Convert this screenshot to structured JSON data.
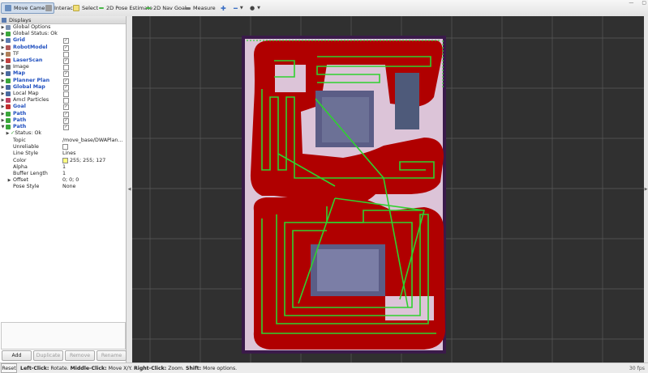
{
  "toolbar": {
    "tools": [
      {
        "label": "Move Camera",
        "icon": "move-camera-icon",
        "active": true
      },
      {
        "label": "Interact",
        "icon": "interact-icon"
      },
      {
        "label": "Select",
        "icon": "select-icon"
      },
      {
        "label": "2D Pose Estimate",
        "icon": "pose-estimate-icon"
      },
      {
        "label": "2D Nav Goal",
        "icon": "nav-goal-icon"
      },
      {
        "label": "Measure",
        "icon": "measure-icon"
      }
    ]
  },
  "displays": {
    "title": "Displays",
    "items": [
      {
        "label": "Global Options",
        "icon": "gear-icon",
        "blue": false,
        "check": null,
        "arrow": "▶"
      },
      {
        "label": "Global Status: Ok",
        "icon": "check-icon",
        "blue": false,
        "check": null,
        "arrow": "▶"
      },
      {
        "label": "Grid",
        "icon": "grid-icon",
        "blue": true,
        "check": true,
        "arrow": "▶"
      },
      {
        "label": "RobotModel",
        "icon": "robot-icon",
        "blue": true,
        "check": true,
        "arrow": "▶"
      },
      {
        "label": "TF",
        "icon": "tf-icon",
        "blue": false,
        "check": false,
        "arrow": "▶"
      },
      {
        "label": "LaserScan",
        "icon": "laser-icon",
        "blue": true,
        "check": true,
        "arrow": "▶"
      },
      {
        "label": "Image",
        "icon": "image-icon",
        "blue": false,
        "check": false,
        "arrow": "▶"
      },
      {
        "label": "Map",
        "icon": "map-icon",
        "blue": true,
        "check": true,
        "arrow": "▶"
      },
      {
        "label": "Planner Plan",
        "icon": "path-icon",
        "blue": true,
        "check": true,
        "arrow": "▶"
      },
      {
        "label": "Global Map",
        "icon": "map-folder-icon",
        "blue": true,
        "check": true,
        "arrow": "▶"
      },
      {
        "label": "Local Map",
        "icon": "map-folder-icon",
        "blue": false,
        "check": false,
        "arrow": "▶"
      },
      {
        "label": "Amcl Particles",
        "icon": "particles-icon",
        "blue": false,
        "check": false,
        "arrow": "▶"
      },
      {
        "label": "Goal",
        "icon": "goal-icon",
        "blue": true,
        "check": true,
        "arrow": "▶"
      },
      {
        "label": "Path",
        "icon": "path-icon",
        "blue": true,
        "check": true,
        "arrow": "▶"
      },
      {
        "label": "Path",
        "icon": "path-icon",
        "blue": true,
        "check": true,
        "arrow": "▶"
      },
      {
        "label": "Path",
        "icon": "path-icon",
        "blue": true,
        "check": true,
        "arrow": "▼"
      }
    ],
    "status_ok": "Status: Ok",
    "properties": [
      {
        "key": "Topic",
        "value": "/move_base/DWAPlan..."
      },
      {
        "key": "Unreliable",
        "value": "",
        "checkbox": true
      },
      {
        "key": "Line Style",
        "value": "Lines"
      },
      {
        "key": "Color",
        "value": "255; 255; 127",
        "swatch": "#ffff7f"
      },
      {
        "key": "Alpha",
        "value": "1"
      },
      {
        "key": "Buffer Length",
        "value": "1"
      },
      {
        "key": "Offset",
        "value": "0; 0; 0",
        "arrow": true
      },
      {
        "key": "Pose Style",
        "value": "None"
      }
    ],
    "buttons": {
      "add": "Add",
      "duplicate": "Duplicate",
      "remove": "Remove",
      "rename": "Rename"
    }
  },
  "status": {
    "reset": "Reset",
    "hint_parts": [
      {
        "t": "Left-Click:",
        "b": true
      },
      {
        "t": " Rotate. ",
        "b": false
      },
      {
        "t": "Middle-Click:",
        "b": true
      },
      {
        "t": " Move X/Y. ",
        "b": false
      },
      {
        "t": "Right-Click:",
        "b": true
      },
      {
        "t": " Zoom. ",
        "b": false
      },
      {
        "t": "Shift:",
        "b": true
      },
      {
        "t": " More options.",
        "b": false
      }
    ],
    "fps": "30 fps"
  },
  "colors": {
    "viewport_bg": "#303030",
    "grid_line": "#5a5a5a",
    "costmap_red": "#b00000",
    "path_green": "#2fd22f",
    "free_space": "#dcc4d8",
    "obstacle_purple": "#3a1a4a"
  }
}
